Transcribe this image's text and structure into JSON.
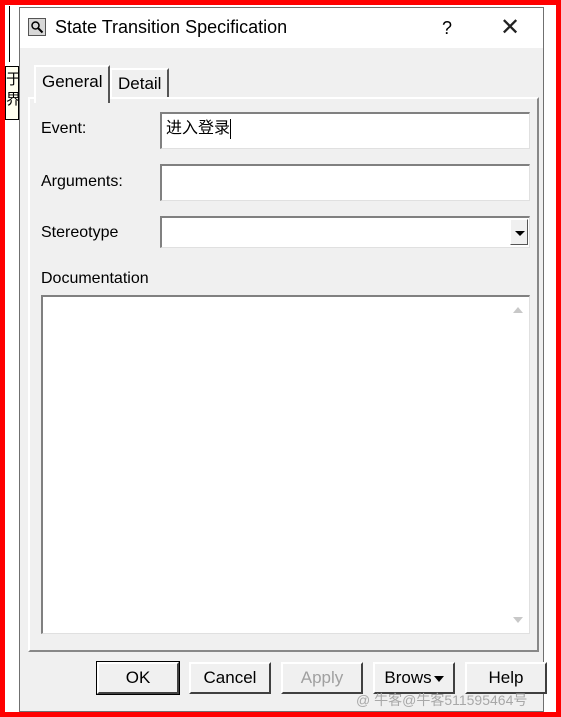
{
  "background_fragment": {
    "line1": "于",
    "line2": "界"
  },
  "dialog": {
    "title": "State Transition Specification",
    "help_glyph": "?",
    "close_glyph": "✕"
  },
  "tabs": [
    {
      "label": "General",
      "selected": true
    },
    {
      "label": "Detail",
      "selected": false
    }
  ],
  "form": {
    "event_label": "Event:",
    "event_value": "进入登录",
    "arguments_label": "Arguments:",
    "arguments_value": "",
    "stereotype_label": "Stereotype",
    "stereotype_value": "",
    "documentation_label": "Documentation",
    "documentation_value": ""
  },
  "buttons": {
    "ok": "OK",
    "cancel": "Cancel",
    "apply": "Apply",
    "browse": "Brows",
    "help": "Help"
  },
  "watermark": "@ 牛客@牛客511595464号",
  "colors": {
    "annotation_frame": "#ff0000",
    "dialog_bg": "#f0f0f0"
  }
}
